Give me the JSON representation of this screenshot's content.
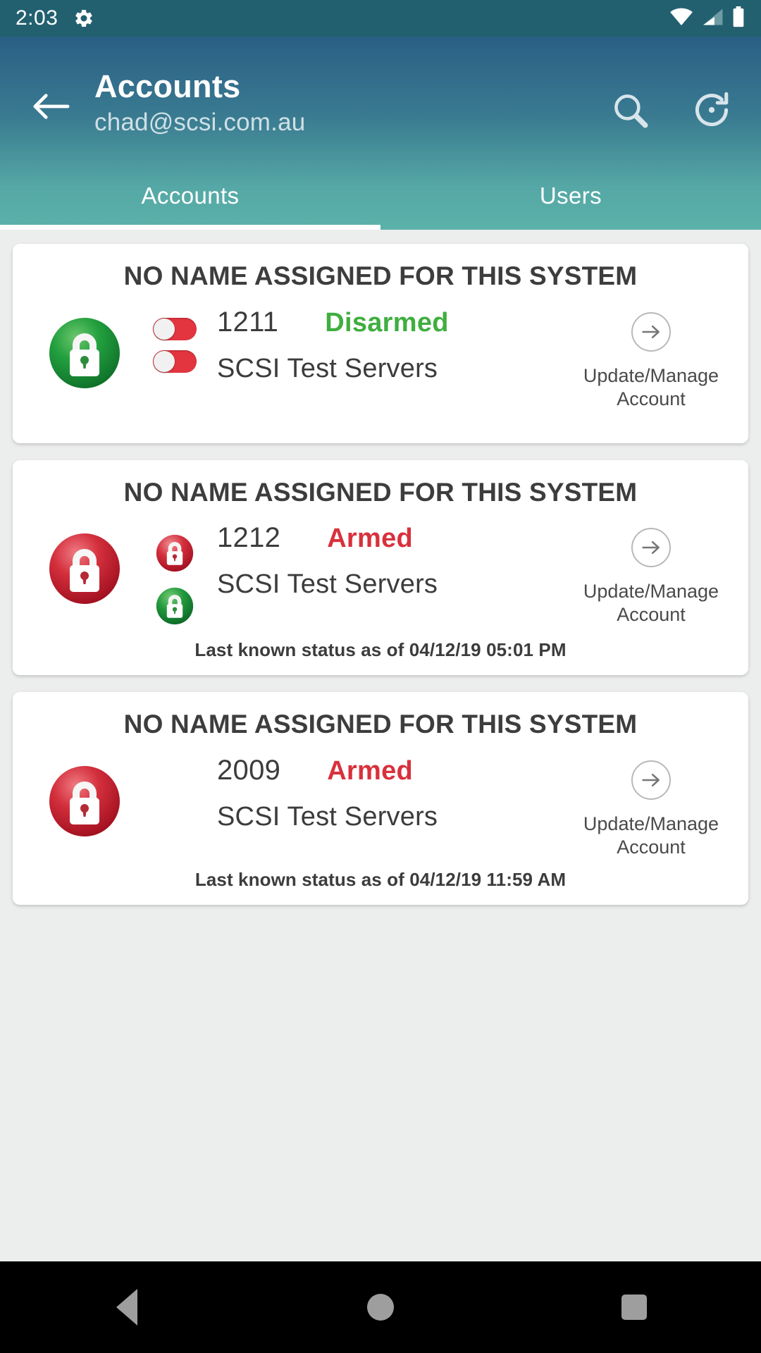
{
  "status_bar": {
    "time": "2:03",
    "icons": [
      "gear-icon",
      "wifi-icon",
      "cellular-icon",
      "battery-icon"
    ]
  },
  "app_bar": {
    "back_icon": "arrow-left-icon",
    "title": "Accounts",
    "subtitle": "chad@scsi.com.au",
    "search_icon": "search-icon",
    "refresh_icon": "refresh-icon"
  },
  "tabs": {
    "items": [
      {
        "label": "Accounts",
        "selected": true
      },
      {
        "label": "Users",
        "selected": false
      }
    ]
  },
  "colors": {
    "status_bar": "#226070",
    "app_bar_top": "#2a5f85",
    "app_bar_bottom": "#5cb1ab",
    "page_background": "#eceded",
    "card_background": "#ffffff",
    "disarmed_green": "#3fae3f",
    "armed_red": "#d8313c",
    "toggle_red": "#e3353f",
    "text_dark": "#3c3c3c"
  },
  "manage": {
    "arrow_icon": "arrow-right-circle-icon",
    "label_line1": "Update/Manage",
    "label_line2": "Account"
  },
  "accounts": [
    {
      "title": "NO NAME ASSIGNED FOR THIS SYSTEM",
      "number": "1211",
      "state": "Disarmed",
      "state_color": "#3fae3f",
      "site_name": "SCSI Test Servers",
      "big_lock": "lock-closed-green-icon",
      "big_lock_color": "green",
      "mini_indicators": [
        {
          "type": "toggle-off-red",
          "icon": "toggle-switch-red-icon"
        },
        {
          "type": "toggle-off-red",
          "icon": "toggle-switch-red-icon"
        }
      ],
      "last_status": ""
    },
    {
      "title": "NO NAME ASSIGNED FOR THIS SYSTEM",
      "number": "1212",
      "state": "Armed",
      "state_color": "#d8313c",
      "site_name": "SCSI Test Servers",
      "big_lock": "lock-closed-red-icon",
      "big_lock_color": "red",
      "mini_indicators": [
        {
          "type": "lock-red",
          "icon": "lock-closed-red-icon"
        },
        {
          "type": "lock-green",
          "icon": "lock-closed-green-icon"
        }
      ],
      "last_status": "Last known status as of 04/12/19 05:01 PM"
    },
    {
      "title": "NO NAME ASSIGNED FOR THIS SYSTEM",
      "number": "2009",
      "state": "Armed",
      "state_color": "#d8313c",
      "site_name": "SCSI Test Servers",
      "big_lock": "lock-closed-red-icon",
      "big_lock_color": "red",
      "mini_indicators": [],
      "last_status": "Last known status as of 04/12/19 11:59 AM"
    }
  ],
  "nav_bar": {
    "back": "nav-back-icon",
    "home": "nav-home-icon",
    "recents": "nav-recents-icon"
  }
}
